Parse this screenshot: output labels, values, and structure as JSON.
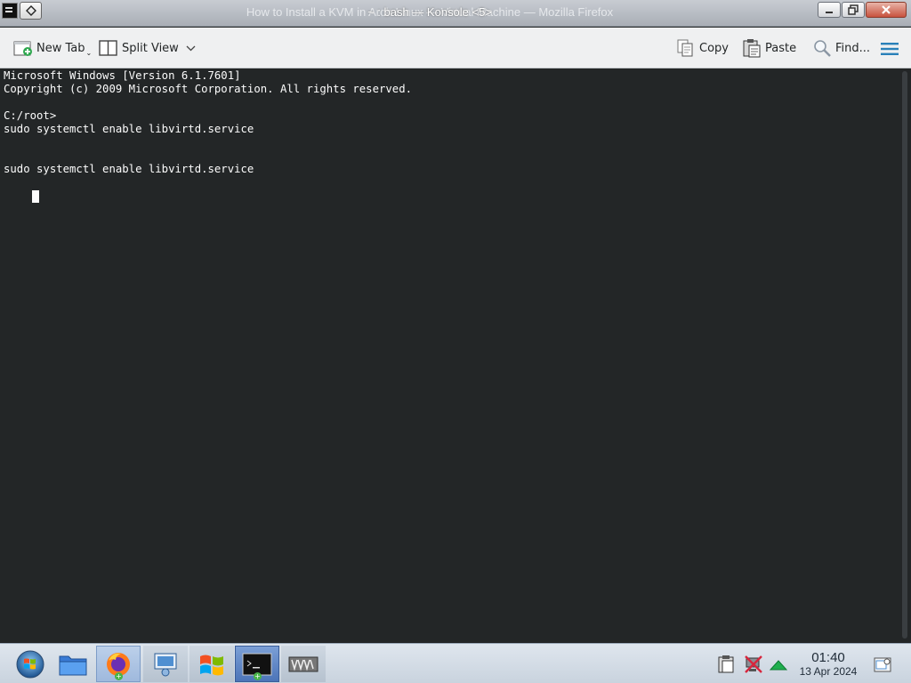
{
  "window": {
    "title_back": "How to Install a KVM in Arch Linux — Virtual Machine — Mozilla Firefox",
    "title_front": "~ : bash — Konsole <5>"
  },
  "toolbar": {
    "new_tab_label": "New Tab",
    "split_view_label": "Split View",
    "copy_label": "Copy",
    "paste_label": "Paste",
    "find_label": "Find..."
  },
  "terminal": {
    "lines": [
      "Microsoft Windows [Version 6.1.7601]",
      "Copyright (c) 2009 Microsoft Corporation. All rights reserved.",
      "",
      "C:/root>",
      "sudo systemctl enable libvirtd.service",
      "",
      "",
      "sudo systemctl enable libvirtd.service"
    ]
  },
  "taskbar": {
    "apps": [
      "start-orb",
      "file-manager",
      "firefox",
      "network-settings",
      "windows-flag",
      "konsole",
      "virt-manager"
    ],
    "time": "01:40",
    "date": "13 Apr 2024"
  },
  "colors": {
    "terminal_bg": "#232627",
    "terminal_fg": "#fcfcfc",
    "toolbar_bg": "#eff0f1",
    "accent": "#3daee9"
  }
}
